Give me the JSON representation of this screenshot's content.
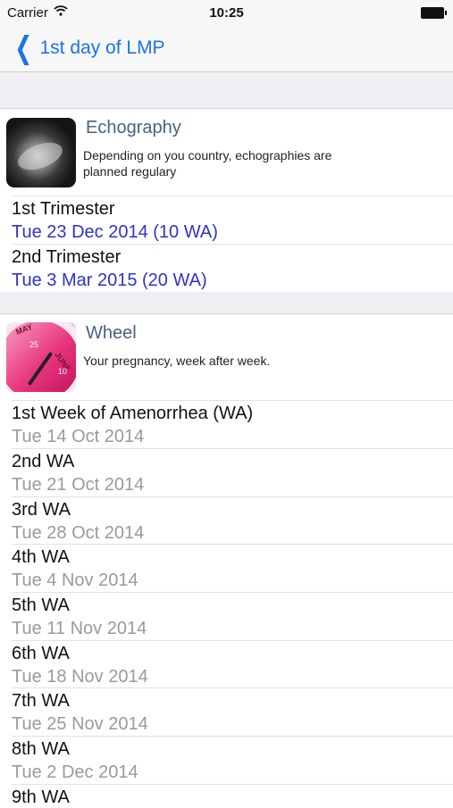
{
  "status_bar": {
    "carrier": "Carrier",
    "time": "10:25"
  },
  "nav": {
    "back_label": "1st day of LMP"
  },
  "echography": {
    "title": "Echography",
    "description": "Depending on you country, echographies are planned regulary",
    "rows": [
      {
        "label": "1st Trimester",
        "value": "Tue 23 Dec 2014 (10 WA)"
      },
      {
        "label": "2nd Trimester",
        "value": "Tue 3 Mar 2015 (20 WA)"
      }
    ]
  },
  "wheel": {
    "title": "Wheel",
    "description": "Your pregnancy, week after week.",
    "thumb_text": {
      "month1": "MAY",
      "month2": "JUNE",
      "n1": "25",
      "n2": "10"
    },
    "rows": [
      {
        "label": "1st Week of Amenorrhea (WA)",
        "value": "Tue 14 Oct 2014"
      },
      {
        "label": "2nd WA",
        "value": "Tue 21 Oct 2014"
      },
      {
        "label": "3rd WA",
        "value": "Tue 28 Oct 2014"
      },
      {
        "label": "4th WA",
        "value": "Tue 4 Nov 2014"
      },
      {
        "label": "5th WA",
        "value": "Tue 11 Nov 2014"
      },
      {
        "label": "6th WA",
        "value": "Tue 18 Nov 2014"
      },
      {
        "label": "7th WA",
        "value": "Tue 25 Nov 2014"
      },
      {
        "label": "8th WA",
        "value": "Tue 2 Dec 2014"
      },
      {
        "label": "9th WA",
        "value": ""
      }
    ]
  },
  "colors": {
    "accent": "#1a74e8",
    "date_blue": "#2c34c7",
    "date_gray": "#9a9a9a",
    "title": "#4a5f86"
  }
}
